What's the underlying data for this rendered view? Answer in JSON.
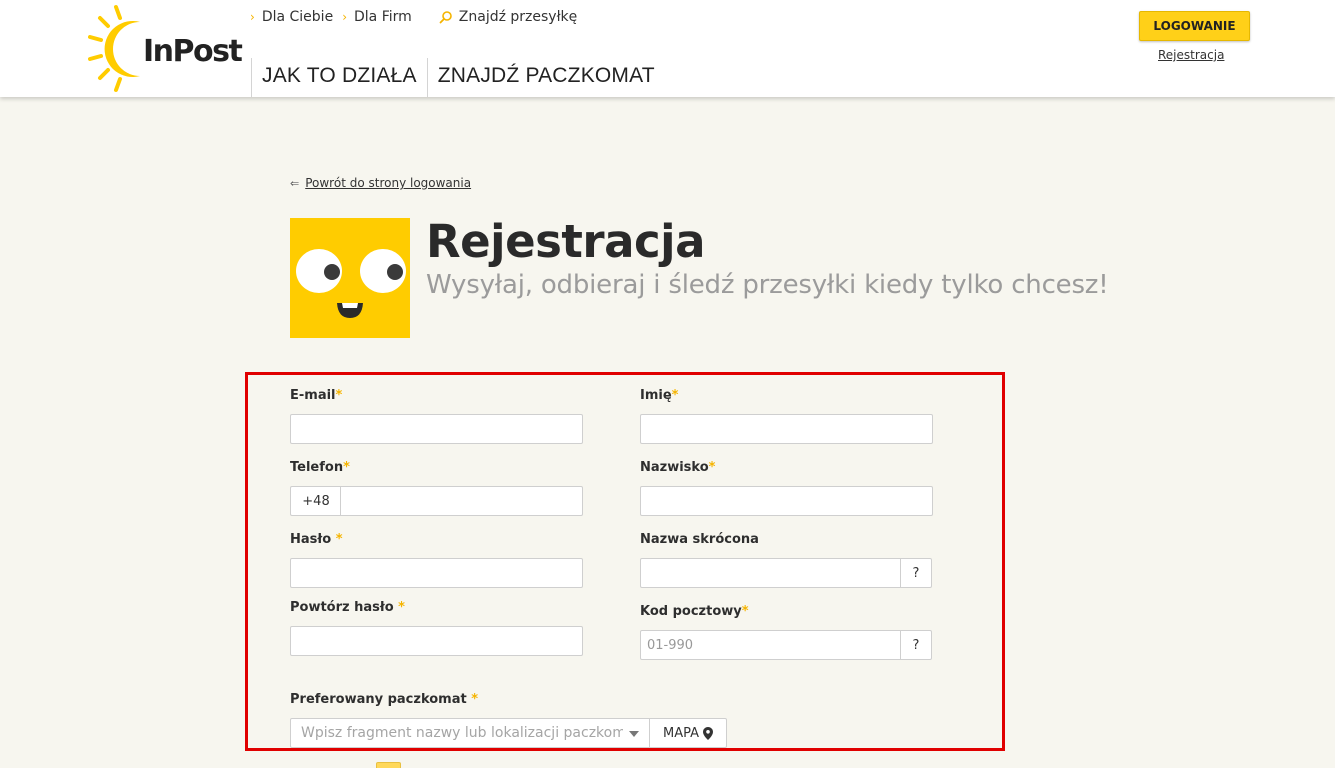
{
  "header": {
    "logo_text": "InPost",
    "top_links": [
      {
        "label": "Dla Ciebie",
        "icon": "chevron-right-icon"
      },
      {
        "label": "Dla Firm",
        "icon": "chevron-right-icon"
      },
      {
        "label": "Znajdź przesyłkę",
        "icon": "search-icon"
      }
    ],
    "nav": [
      {
        "label": "JAK TO DZIAŁA"
      },
      {
        "label": "ZNAJDŹ PACZKOMAT"
      }
    ],
    "login_label": "LOGOWANIE",
    "register_label": "Rejestracja"
  },
  "back_link": {
    "arrow": "⇐",
    "label": "Powrót do strony logowania"
  },
  "hero": {
    "title": "Rejestracja",
    "subtitle": "Wysyłaj, odbieraj i śledź przesyłki kiedy tylko chcesz!"
  },
  "form": {
    "email_label": "E-mail",
    "first_name_label": "Imię",
    "phone_label": "Telefon",
    "phone_prefix": "+48",
    "last_name_label": "Nazwisko",
    "password_label": "Hasło",
    "short_name_label": "Nazwa skrócona",
    "repeat_password_label": "Powtórz hasło",
    "postal_code_label": "Kod pocztowy",
    "postal_code_placeholder": "01-990",
    "help_symbol": "?",
    "required_marker": "*",
    "locker_label": "Preferowany paczkomat",
    "locker_placeholder": "Wpisz fragment nazwy lub lokalizacji paczkomatu",
    "map_label": "MAPA"
  },
  "colors": {
    "brand_yellow": "#ffd018",
    "required_star": "#f5b400",
    "highlight_frame": "#e00000",
    "page_background": "#f7f6ef"
  }
}
